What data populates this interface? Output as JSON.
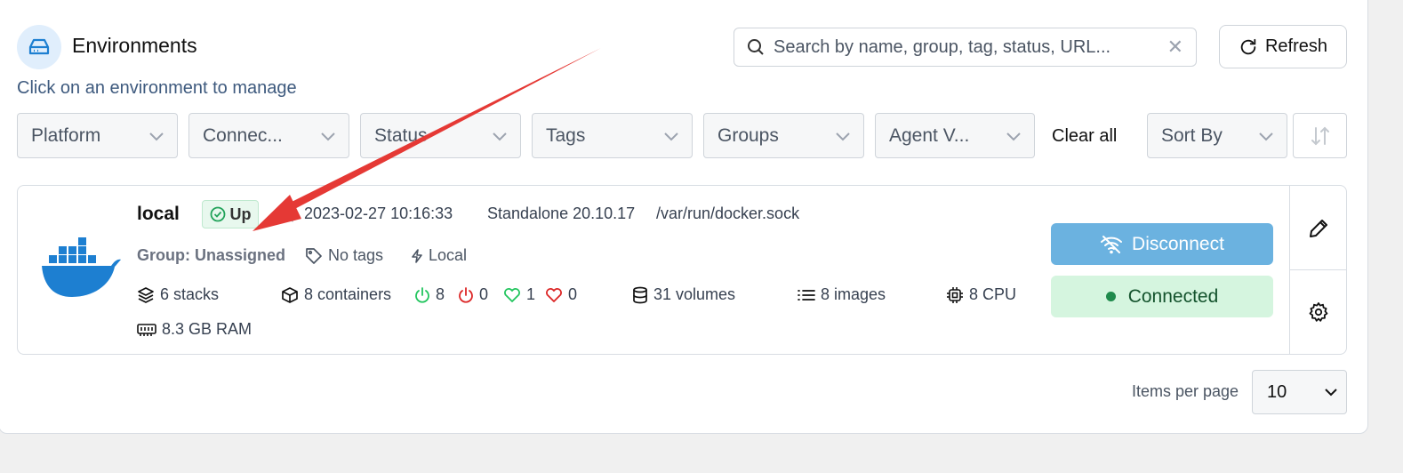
{
  "header": {
    "title": "Environments",
    "subtitle": "Click on an environment to manage",
    "search_placeholder": "Search by name, group, tag, status, URL...",
    "refresh_label": "Refresh"
  },
  "filters": [
    {
      "label": "Platform"
    },
    {
      "label": "Connec..."
    },
    {
      "label": "Status"
    },
    {
      "label": "Tags"
    },
    {
      "label": "Groups"
    },
    {
      "label": "Agent V..."
    }
  ],
  "clear_all_label": "Clear all",
  "sort_by_label": "Sort By",
  "environment": {
    "name": "local",
    "status": "Up",
    "timestamp": "2023-02-27 10:16:33",
    "type": "Standalone 20.10.17",
    "url": "/var/run/docker.sock",
    "group": "Group: Unassigned",
    "tags": "No tags",
    "mode": "Local",
    "stacks": "6 stacks",
    "containers": "8 containers",
    "running": "8",
    "stopped": "0",
    "healthy": "1",
    "unhealthy": "0",
    "volumes": "31 volumes",
    "images": "8 images",
    "cpu": "8 CPU",
    "ram": "8.3 GB RAM",
    "disconnect_label": "Disconnect",
    "connected_label": "Connected"
  },
  "pagination": {
    "items_per_page_label": "Items per page",
    "items_per_page_value": "10"
  },
  "colors": {
    "accent": "#1d7fd1",
    "disconnect_bg": "#6bb2e0",
    "connected_bg": "#d5f5df",
    "running": "#22c55e",
    "stopped": "#dc2626",
    "annotation_arrow": "#e53935"
  }
}
